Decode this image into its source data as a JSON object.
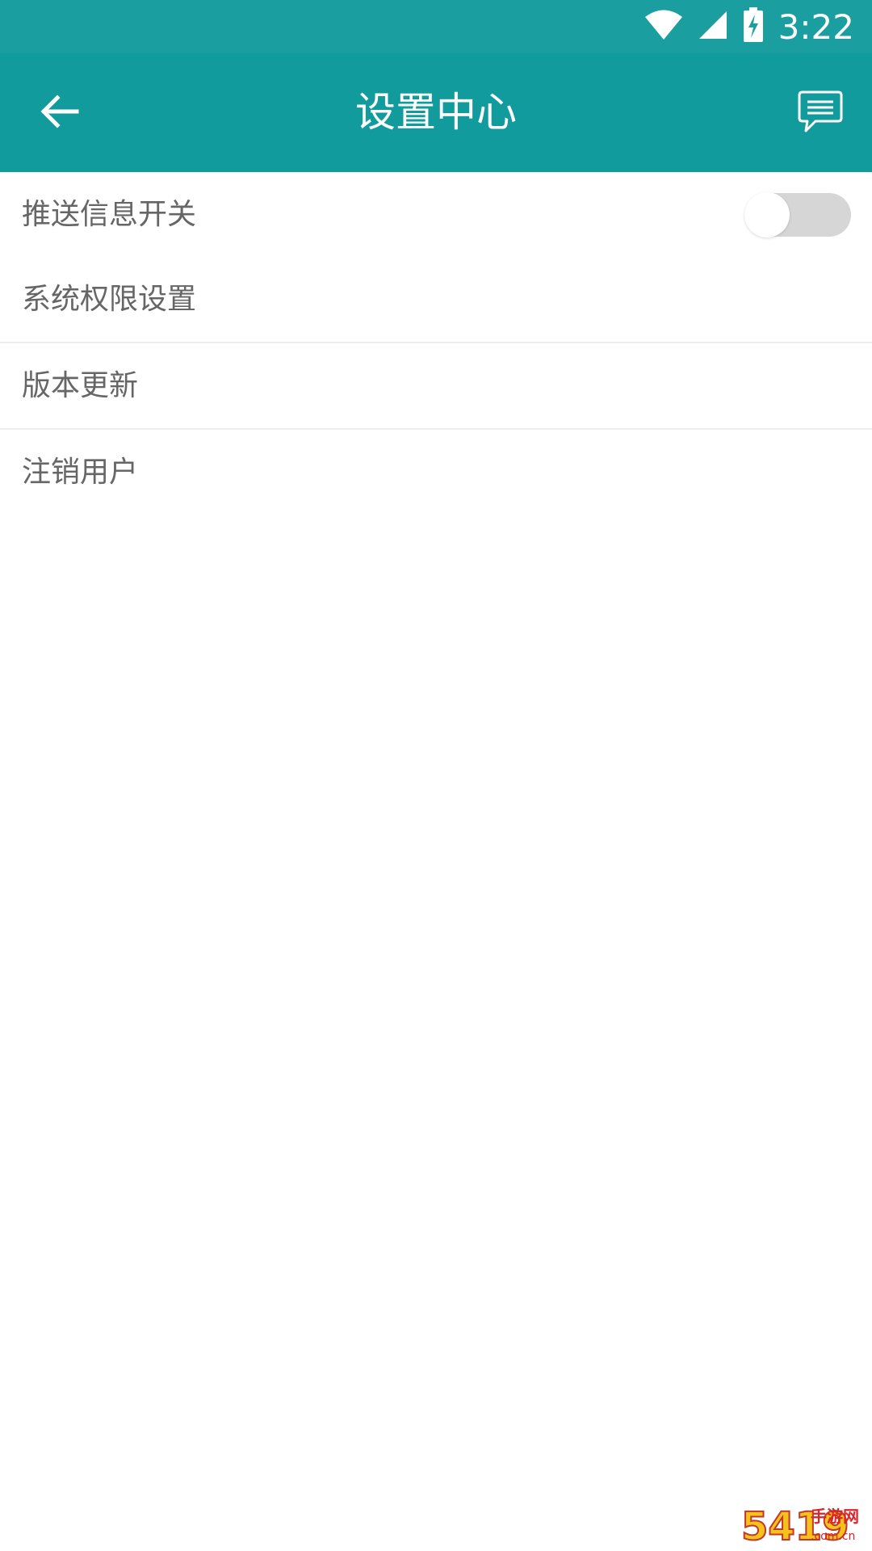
{
  "status_bar": {
    "time": "3:22",
    "icons": [
      "wifi-icon",
      "cellular-signal-icon",
      "battery-charging-icon"
    ]
  },
  "app_bar": {
    "title": "设置中心",
    "back_icon": "arrow-left-icon",
    "action_icon": "message-icon"
  },
  "settings": {
    "items": [
      {
        "label": "推送信息开关",
        "has_toggle": true,
        "toggle_on": false
      },
      {
        "label": "系统权限设置"
      },
      {
        "label": "版本更新"
      },
      {
        "label": "注销用户"
      }
    ]
  },
  "watermark": {
    "brand": "5419",
    "text": "手游网",
    "domain": ".com.cn"
  },
  "colors": {
    "status_bar": "#1a9ea0",
    "app_bar": "#119b9c",
    "item_text": "#666666",
    "toggle_track_off": "#d6d6d6",
    "divider": "#eeeeee"
  }
}
